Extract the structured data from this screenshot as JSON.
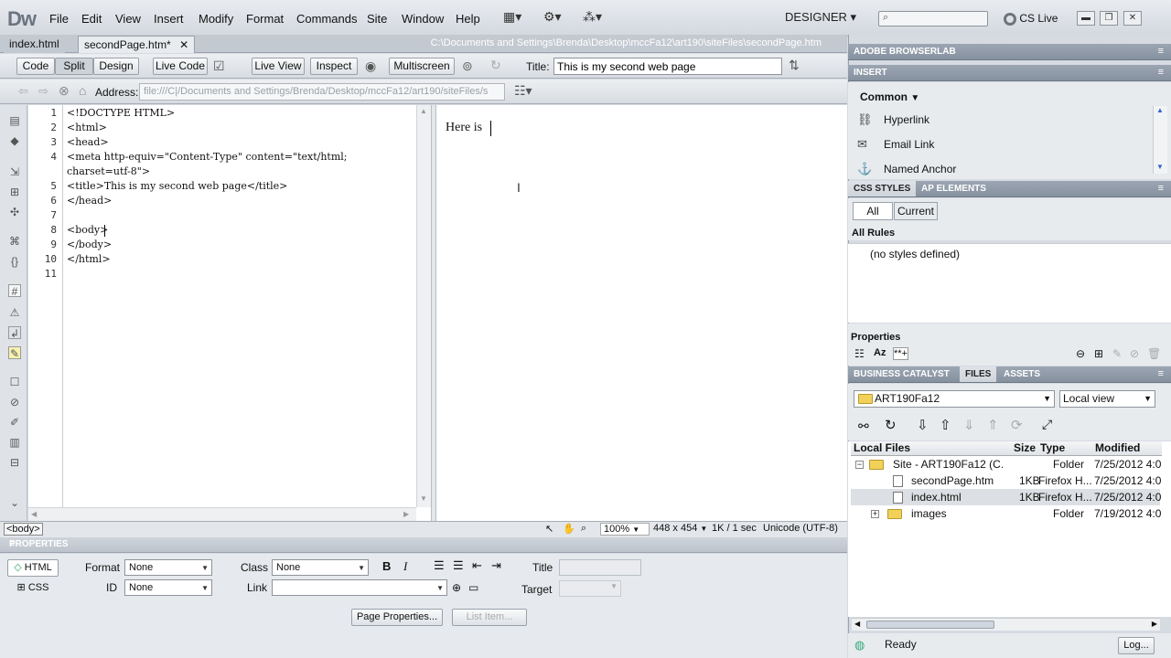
{
  "app": {
    "logo": "Dw",
    "menu": [
      "File",
      "Edit",
      "View",
      "Insert",
      "Modify",
      "Format",
      "Commands",
      "Site",
      "Window",
      "Help"
    ],
    "workspace": "DESIGNER",
    "cs_live": "CS Live"
  },
  "documents": {
    "tabs": [
      "index.html",
      "secondPage.htm*"
    ],
    "path": "C:\\Documents and Settings\\Brenda\\Desktop\\mccFa12\\art190\\siteFiles\\secondPage.htm"
  },
  "toolbar": {
    "code": "Code",
    "split": "Split",
    "design": "Design",
    "live_code": "Live Code",
    "live_view": "Live View",
    "inspect": "Inspect",
    "multiscreen": "Multiscreen",
    "title_label": "Title:",
    "title_value": "This is my second web page"
  },
  "address": {
    "label": "Address:",
    "value": "file:///C|/Documents and Settings/Brenda/Desktop/mccFa12/art190/siteFiles/s"
  },
  "code_view": {
    "line_numbers": [
      "1",
      "2",
      "3",
      "4",
      "",
      "5",
      "6",
      "7",
      "8",
      "9",
      "10",
      "11"
    ],
    "lines": [
      "<!DOCTYPE HTML>",
      "<html>",
      "<head>",
      "<meta http-equiv=\"Content-Type\" content=\"text/html;",
      "charset=utf-8\">",
      "<title>This is my second web page</title>",
      "</head>",
      "",
      "<body>",
      "</body>",
      "</html>",
      ""
    ]
  },
  "design_view": {
    "text": "Here is"
  },
  "status": {
    "tag": "<body>",
    "zoom": "100%",
    "size": "448 x 454",
    "speed": "1K / 1 sec",
    "encoding": "Unicode (UTF-8)"
  },
  "properties": {
    "header": "PROPERTIES",
    "html_btn": "HTML",
    "css_btn": "CSS",
    "format_label": "Format",
    "format_value": "None",
    "id_label": "ID",
    "id_value": "None",
    "class_label": "Class",
    "class_value": "None",
    "link_label": "Link",
    "title_label": "Title",
    "target_label": "Target",
    "page_properties": "Page Properties...",
    "list_item": "List Item..."
  },
  "panels": {
    "browserlab": "ADOBE BROWSERLAB",
    "insert": "INSERT",
    "insert_category": "Common",
    "insert_items": [
      "Hyperlink",
      "Email Link",
      "Named Anchor"
    ],
    "css_styles": "CSS STYLES",
    "ap_elements": "AP ELEMENTS",
    "css_all": "All",
    "css_current": "Current",
    "all_rules": "All Rules",
    "no_styles": "(no styles defined)",
    "properties": "Properties",
    "business_catalyst": "BUSINESS CATALYST",
    "files": "FILES",
    "assets": "ASSETS",
    "site_select": "ART190Fa12",
    "view_select": "Local view",
    "file_headers": {
      "name": "Local Files",
      "size": "Size",
      "type": "Type",
      "modified": "Modified"
    },
    "file_rows": [
      {
        "name": "Site - ART190Fa12 (C...",
        "size": "",
        "type": "Folder",
        "modified": "7/25/2012 4:0"
      },
      {
        "name": "secondPage.htm",
        "size": "1KB",
        "type": "Firefox H...",
        "modified": "7/25/2012 4:0"
      },
      {
        "name": "index.html",
        "size": "1KB",
        "type": "Firefox H...",
        "modified": "7/25/2012 4:0"
      },
      {
        "name": "images",
        "size": "",
        "type": "Folder",
        "modified": "7/19/2012 4:0"
      }
    ],
    "ready": "Ready",
    "log": "Log..."
  }
}
